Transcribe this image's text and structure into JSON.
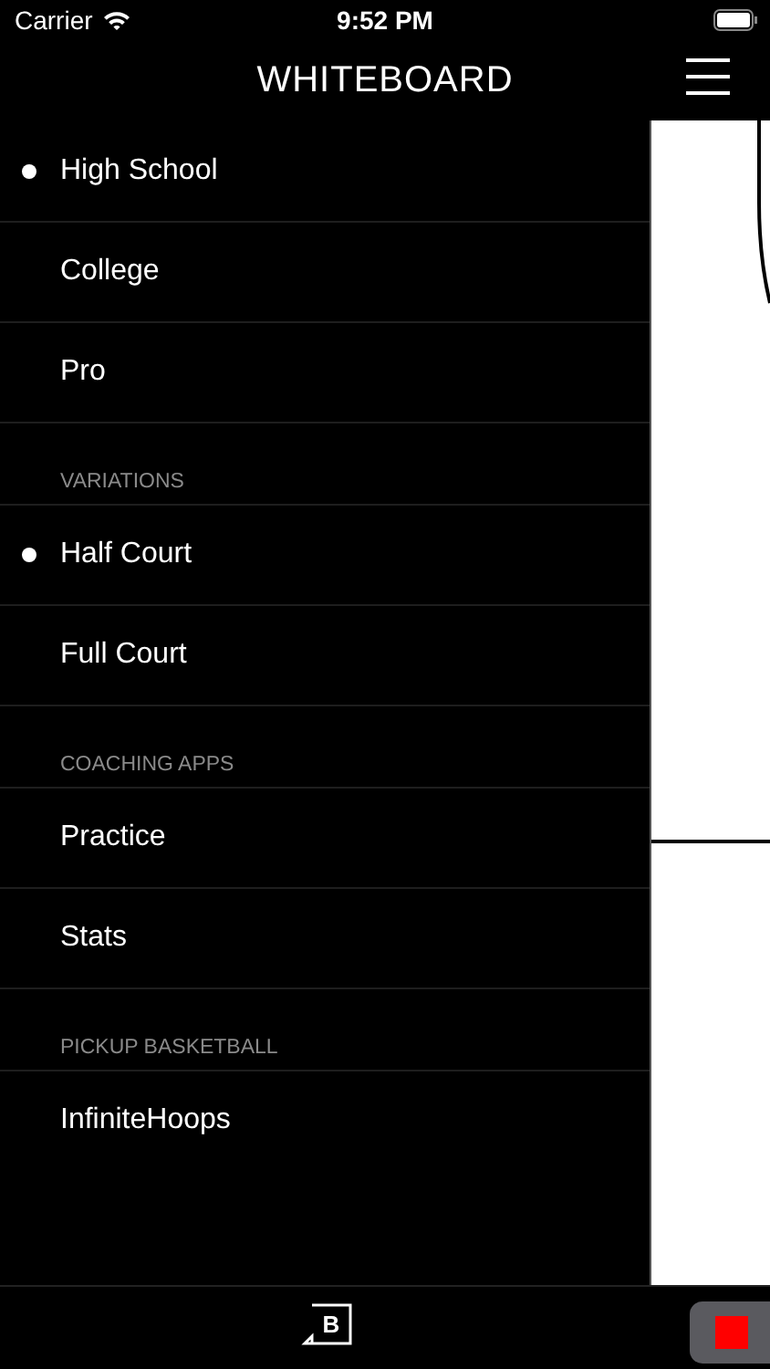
{
  "status_bar": {
    "carrier": "Carrier",
    "time": "9:52 PM"
  },
  "header": {
    "title": "WHITEBOARD"
  },
  "bottom_bar": {
    "logo": "B"
  },
  "menu": [
    {
      "items": [
        {
          "label": "High School",
          "selected": true
        },
        {
          "label": "College",
          "selected": false
        },
        {
          "label": "Pro",
          "selected": false
        }
      ]
    },
    {
      "header": "VARIATIONS",
      "items": [
        {
          "label": "Half Court",
          "selected": true
        },
        {
          "label": "Full Court",
          "selected": false
        }
      ]
    },
    {
      "header": "COACHING APPS",
      "items": [
        {
          "label": "Practice",
          "selected": false
        },
        {
          "label": "Stats",
          "selected": false
        }
      ]
    },
    {
      "header": "PICKUP BASKETBALL",
      "items": [
        {
          "label": "InfiniteHoops",
          "selected": false
        }
      ]
    }
  ]
}
